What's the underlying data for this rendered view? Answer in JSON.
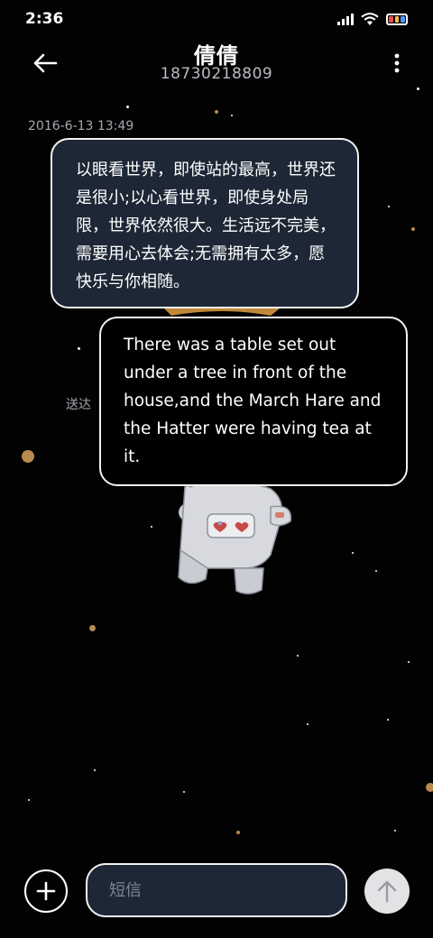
{
  "status_bar": {
    "time": "2:36",
    "signal_icon": "cellular-signal-icon",
    "wifi_icon": "wifi-icon",
    "battery_icon": "battery-icon",
    "battery_colors": [
      "#e8524a",
      "#f5c04a",
      "#4a9af5"
    ]
  },
  "header": {
    "contact_name": "倩倩",
    "contact_number": "18730218809",
    "back_icon": "back-arrow-icon",
    "more_icon": "more-vertical-icon"
  },
  "conversation": {
    "timestamp": "2016-6-13 13:49",
    "incoming_message": "以眼看世界，即使站的最高，世界还是很小;以心看世界，即使身处局限，世界依然很大。生活远不完美，需要用心去体会;无需拥有太多，愿快乐与你相随。",
    "outgoing_message": "There was a table set out under a tree in front of the house,and the March Hare and the Hatter were having tea at it.",
    "delivery_status": "送达"
  },
  "composer": {
    "add_icon": "plus-circle-icon",
    "placeholder": "短信",
    "value": "",
    "send_icon": "send-arrow-up-icon"
  },
  "colors": {
    "background": "#020203",
    "incoming_bubble": "#1e2736",
    "bubble_border": "#f2f2f2",
    "secondary_text": "#a6a9b0",
    "send_button": "#e2e3e5"
  }
}
